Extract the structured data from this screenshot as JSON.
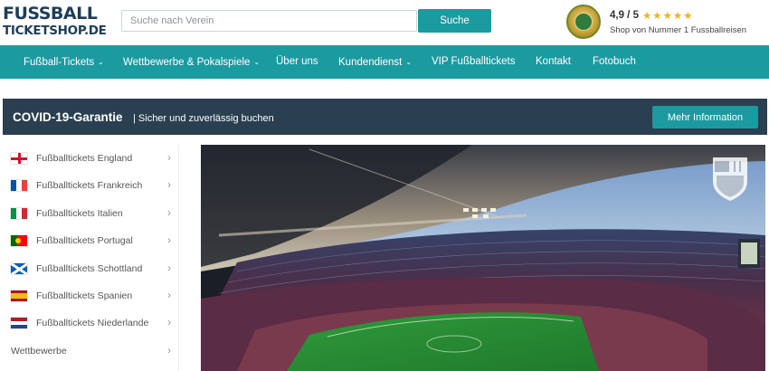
{
  "header": {
    "logo_line1": "FUSSBALL",
    "logo_line2": "TICKETSHOP.DE",
    "search_placeholder": "Suche nach Verein",
    "search_button": "Suche",
    "rating_score": "4,9 / 5",
    "rating_stars": "★★★★★",
    "rating_text": "Shop von Nummer 1 Fussballreisen"
  },
  "nav": {
    "items": [
      {
        "label": "Fußball-Tickets",
        "dropdown": true
      },
      {
        "label": "Wettbewerbe & Pokalspiele",
        "dropdown": true
      },
      {
        "label": "Über uns",
        "dropdown": false
      },
      {
        "label": "Kundendienst",
        "dropdown": true
      },
      {
        "label": "VIP Fußballtickets",
        "dropdown": false
      },
      {
        "label": "Kontakt",
        "dropdown": false
      },
      {
        "label": "Fotobuch",
        "dropdown": false
      }
    ],
    "chevron": "⌄"
  },
  "covid": {
    "title": "COVID-19-Garantie",
    "subtitle": "| Sicher und zuverlässig buchen",
    "button": "Mehr Information"
  },
  "sidebar": {
    "items": [
      {
        "label": "Fußballtickets England",
        "flag": "england"
      },
      {
        "label": "Fußballtickets Frankreich",
        "flag": "france"
      },
      {
        "label": "Fußballtickets Italien",
        "flag": "italy"
      },
      {
        "label": "Fußballtickets Portugal",
        "flag": "portugal"
      },
      {
        "label": "Fußballtickets Schottland",
        "flag": "scotland"
      },
      {
        "label": "Fußballtickets Spanien",
        "flag": "spain"
      },
      {
        "label": "Fußballtickets Niederlande",
        "flag": "netherlands"
      },
      {
        "label": "Wettbewerbe",
        "flag": ""
      }
    ],
    "arrow": "›"
  },
  "hero": {
    "image": "stadium-photo",
    "crest": "fc-barcelona-crest"
  },
  "colors": {
    "teal": "#1b9aa0",
    "dark_navy": "#2a3f50",
    "logo_navy": "#1f3d57",
    "star_gold": "#f0b321"
  }
}
